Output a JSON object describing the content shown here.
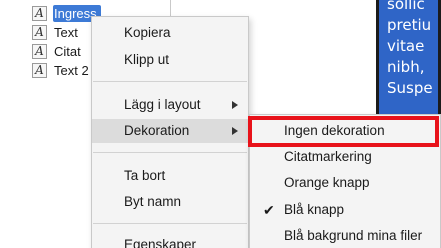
{
  "tree": {
    "items": [
      {
        "icon": "A",
        "label": "Ingress",
        "selected": true
      },
      {
        "icon": "A",
        "label": "Text",
        "selected": false
      },
      {
        "icon": "A",
        "label": "Citat",
        "selected": false
      },
      {
        "icon": "A",
        "label": "Text 2",
        "selected": false
      }
    ]
  },
  "preview": {
    "lines": [
      "sollic",
      "pretiu",
      "vitae",
      "nibh,",
      "Suspe"
    ]
  },
  "context_menu": {
    "copy": "Kopiera",
    "cut": "Klipp ut",
    "add_to_layout": "Lägg i layout",
    "decoration": "Dekoration",
    "delete": "Ta bort",
    "rename": "Byt namn",
    "properties": "Egenskaper"
  },
  "decoration_submenu": {
    "none": "Ingen dekoration",
    "quote_marking": "Citatmarkering",
    "orange_button": "Orange knapp",
    "blue_button": "Blå knapp",
    "blue_background_files": "Blå bakgrund mina filer",
    "checked_item": "Blå knapp"
  },
  "colors": {
    "selection": "#3d7ad6",
    "highlight_border": "#e8121a",
    "preview_background": "#2f65c7"
  }
}
